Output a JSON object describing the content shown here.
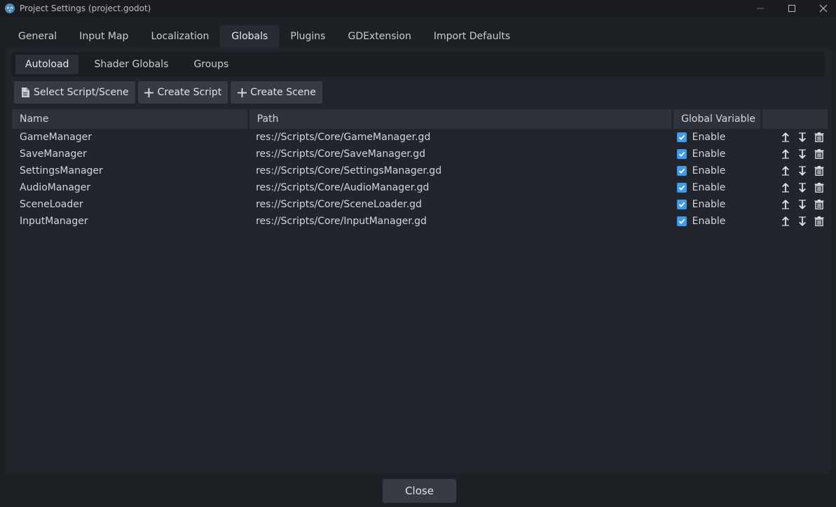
{
  "window": {
    "title": "Project Settings (project.godot)"
  },
  "tabs": [
    "General",
    "Input Map",
    "Localization",
    "Globals",
    "Plugins",
    "GDExtension",
    "Import Defaults"
  ],
  "active_tab": "Globals",
  "subtabs": [
    "Autoload",
    "Shader Globals",
    "Groups"
  ],
  "active_subtab": "Autoload",
  "toolbar": {
    "select_label": "Select Script/Scene",
    "create_script_label": "Create Script",
    "create_scene_label": "Create Scene"
  },
  "table": {
    "headers": [
      "Name",
      "Path",
      "Global Variable",
      ""
    ],
    "rows": [
      {
        "name": "GameManager",
        "path": "res://Scripts/Core/GameManager.gd",
        "enabled": true,
        "enable_label": "Enable"
      },
      {
        "name": "SaveManager",
        "path": "res://Scripts/Core/SaveManager.gd",
        "enabled": true,
        "enable_label": "Enable"
      },
      {
        "name": "SettingsManager",
        "path": "res://Scripts/Core/SettingsManager.gd",
        "enabled": true,
        "enable_label": "Enable"
      },
      {
        "name": "AudioManager",
        "path": "res://Scripts/Core/AudioManager.gd",
        "enabled": true,
        "enable_label": "Enable"
      },
      {
        "name": "SceneLoader",
        "path": "res://Scripts/Core/SceneLoader.gd",
        "enabled": true,
        "enable_label": "Enable"
      },
      {
        "name": "InputManager",
        "path": "res://Scripts/Core/InputManager.gd",
        "enabled": true,
        "enable_label": "Enable"
      }
    ]
  },
  "footer": {
    "close_label": "Close"
  },
  "colors": {
    "accent": "#3d9be9",
    "background": "#1d2025",
    "panel": "#22262c"
  }
}
